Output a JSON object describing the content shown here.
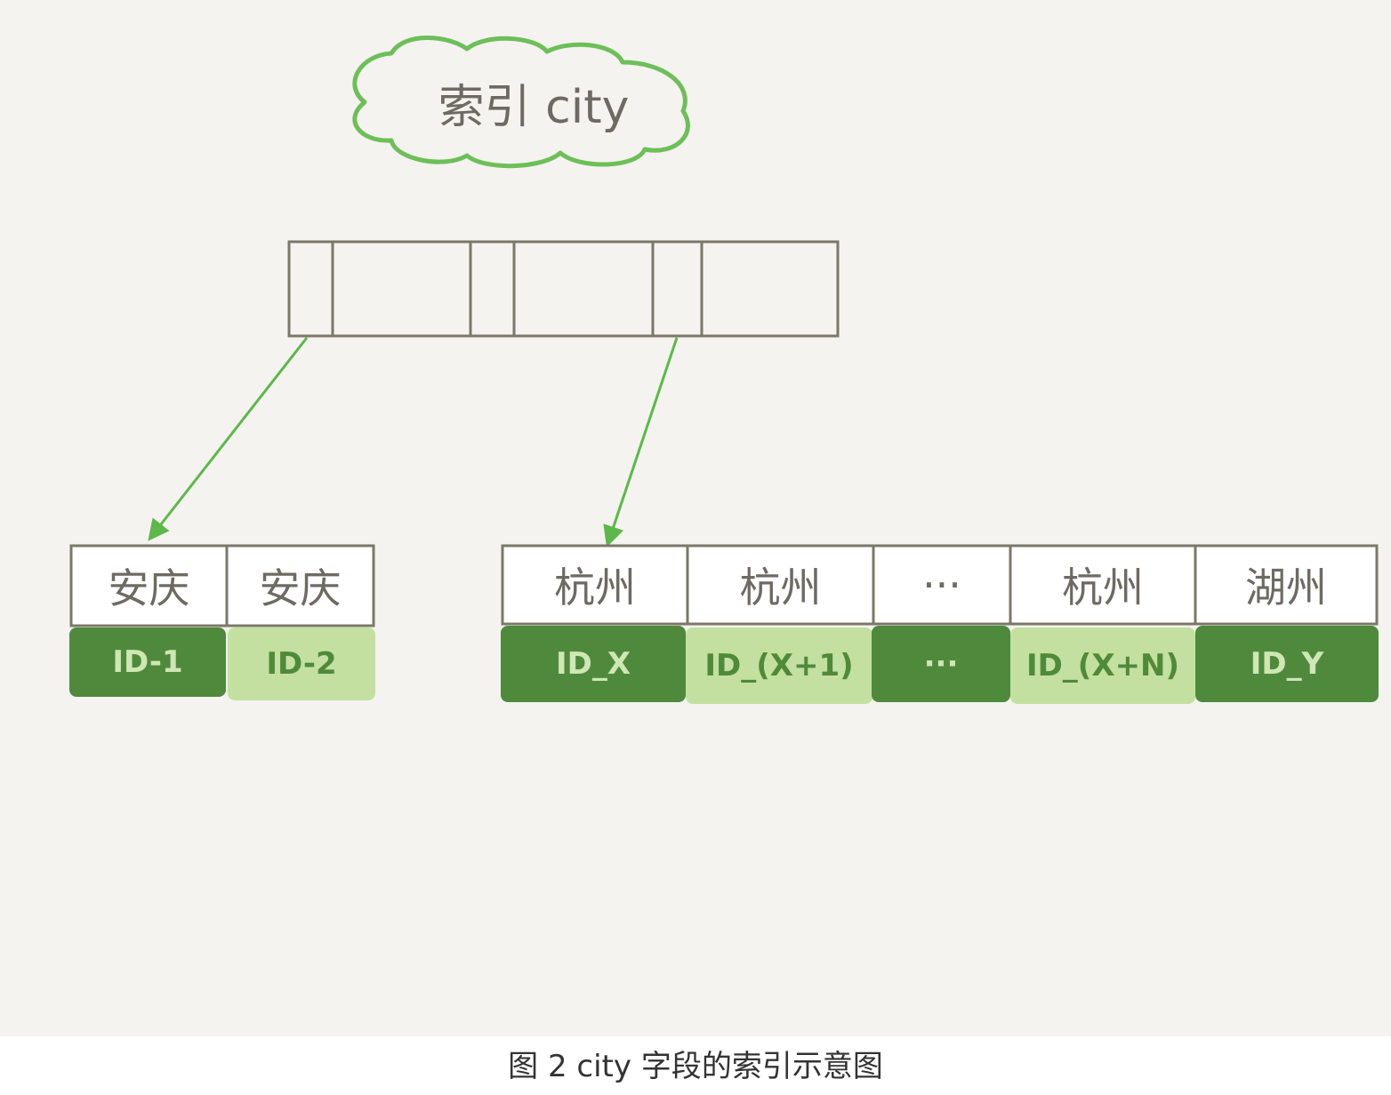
{
  "index_title": "索引 city",
  "internal_node": {
    "slots": 6
  },
  "leaf_left": {
    "keys": [
      "安庆",
      "安庆"
    ],
    "ids": [
      "ID-1",
      "ID-2"
    ],
    "shades": [
      "dark",
      "light"
    ]
  },
  "leaf_right": {
    "keys": [
      "杭州",
      "杭州",
      "···",
      "杭州",
      "湖州"
    ],
    "ids": [
      "ID_X",
      "ID_(X+1)",
      "···",
      "ID_(X+N)",
      "ID_Y"
    ],
    "shades": [
      "dark",
      "light",
      "dark",
      "light",
      "dark"
    ]
  },
  "caption": "图 2 city 字段的索引示意图",
  "colors": {
    "background": "#f4f3ef",
    "outline": "#7a7868",
    "arrow": "#5cb84a",
    "cloud": "#6dbf59",
    "id_dark": "#4f8a3c",
    "id_light": "#c3e0a0"
  }
}
